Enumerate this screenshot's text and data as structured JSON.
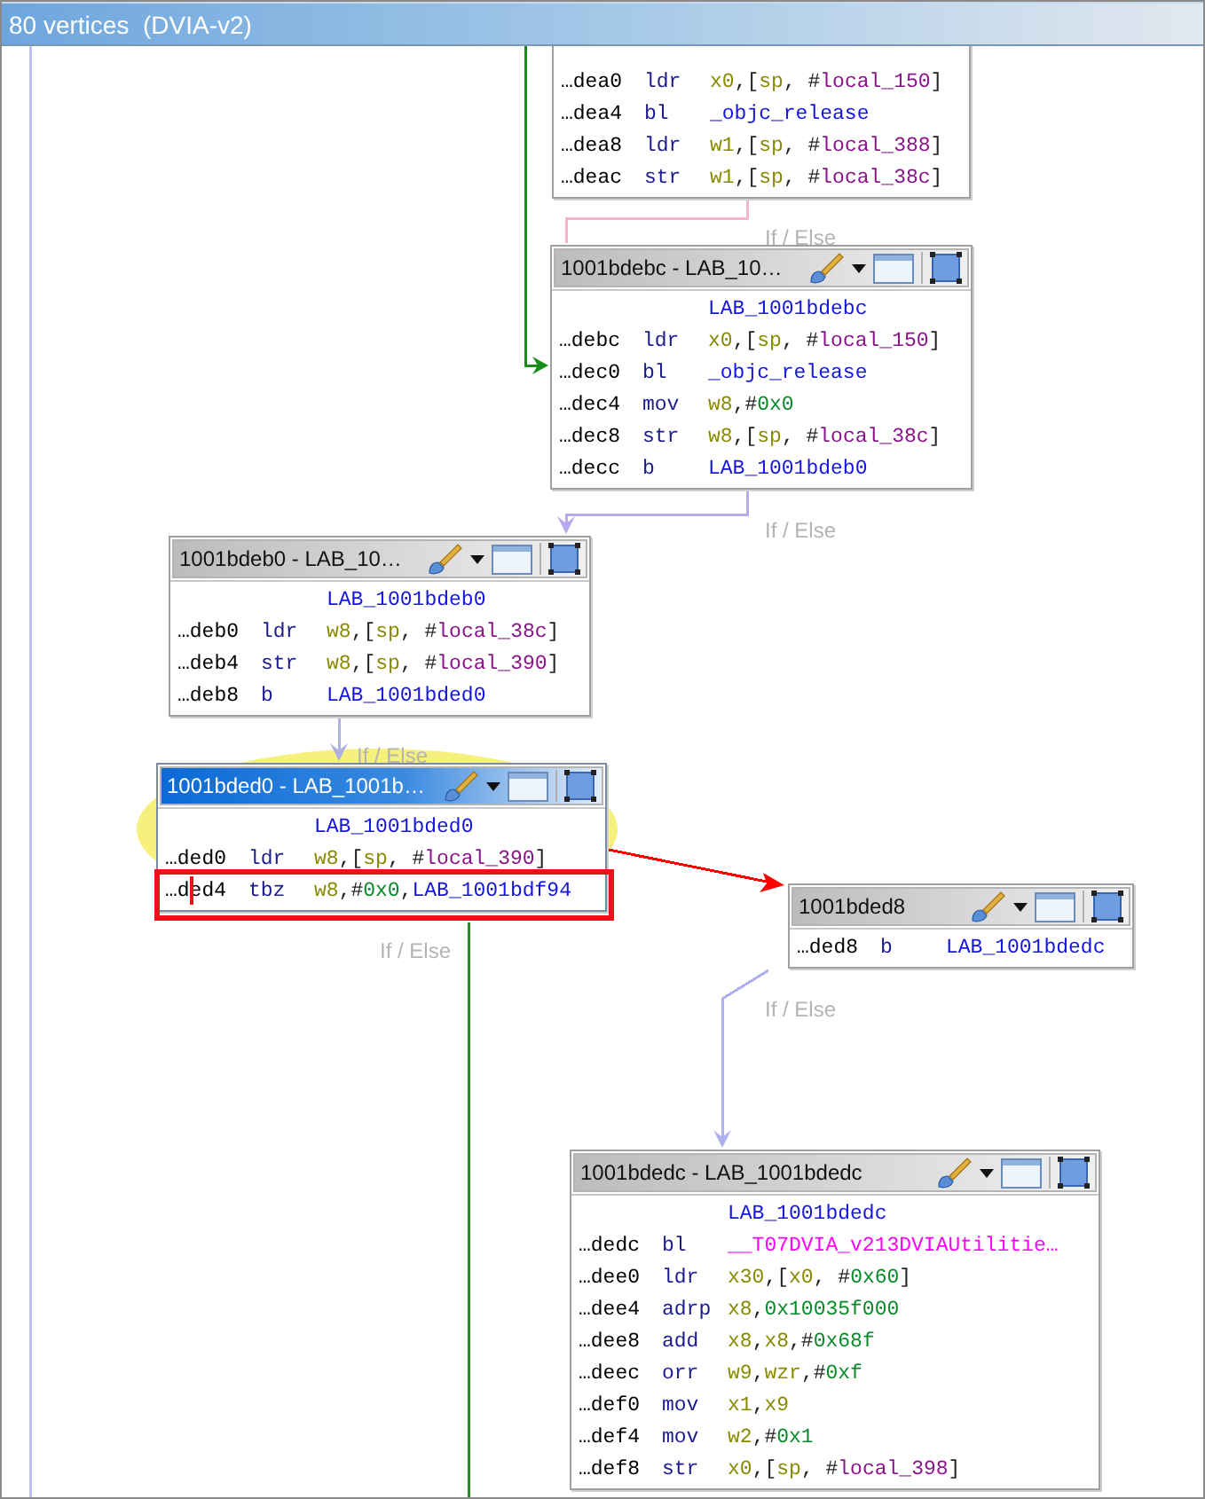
{
  "window": {
    "title": "80 vertices  (DVIA-v2)"
  },
  "blocks": [
    {
      "selected": false,
      "highlighted": false,
      "rows": [
        {
          "address": "…dea0",
          "mnemonic": "ldr",
          "selected": false,
          "operands": [
            {
              "t": "x0",
              "kind": "reg"
            },
            {
              "t": ",[",
              "kind": "punct"
            },
            {
              "t": "sp",
              "kind": "reg"
            },
            {
              "t": ", #",
              "kind": "punct"
            },
            {
              "t": "local_150",
              "kind": "local"
            },
            {
              "t": "]",
              "kind": "punct"
            }
          ]
        },
        {
          "address": "…dea4",
          "mnemonic": "bl",
          "selected": false,
          "operands": [
            {
              "t": "_objc_release",
              "kind": "label"
            }
          ]
        },
        {
          "address": "…dea8",
          "mnemonic": "ldr",
          "selected": false,
          "operands": [
            {
              "t": "w1",
              "kind": "reg"
            },
            {
              "t": ",[",
              "kind": "punct"
            },
            {
              "t": "sp",
              "kind": "reg"
            },
            {
              "t": ", #",
              "kind": "punct"
            },
            {
              "t": "local_388",
              "kind": "local"
            },
            {
              "t": "]",
              "kind": "punct"
            }
          ]
        },
        {
          "address": "…deac",
          "mnemonic": "str",
          "selected": false,
          "operands": [
            {
              "t": "w1",
              "kind": "reg"
            },
            {
              "t": ",[",
              "kind": "punct"
            },
            {
              "t": "sp",
              "kind": "reg"
            },
            {
              "t": ", #",
              "kind": "punct"
            },
            {
              "t": "local_38c",
              "kind": "local"
            },
            {
              "t": "]",
              "kind": "punct"
            }
          ]
        }
      ]
    },
    {
      "title": "1001bdebc - LAB_10…",
      "selected": false,
      "highlighted": false,
      "label": "LAB_1001bdebc",
      "rows": [
        {
          "address": "…debc",
          "mnemonic": "ldr",
          "selected": false,
          "operands": [
            {
              "t": "x0",
              "kind": "reg"
            },
            {
              "t": ",[",
              "kind": "punct"
            },
            {
              "t": "sp",
              "kind": "reg"
            },
            {
              "t": ", #",
              "kind": "punct"
            },
            {
              "t": "local_150",
              "kind": "local"
            },
            {
              "t": "]",
              "kind": "punct"
            }
          ]
        },
        {
          "address": "…dec0",
          "mnemonic": "bl",
          "selected": false,
          "operands": [
            {
              "t": "_objc_release",
              "kind": "label"
            }
          ]
        },
        {
          "address": "…dec4",
          "mnemonic": "mov",
          "selected": false,
          "operands": [
            {
              "t": "w8",
              "kind": "reg"
            },
            {
              "t": ",#",
              "kind": "punct"
            },
            {
              "t": "0x0",
              "kind": "num"
            }
          ]
        },
        {
          "address": "…dec8",
          "mnemonic": "str",
          "selected": false,
          "operands": [
            {
              "t": "w8",
              "kind": "reg"
            },
            {
              "t": ",[",
              "kind": "punct"
            },
            {
              "t": "sp",
              "kind": "reg"
            },
            {
              "t": ", #",
              "kind": "punct"
            },
            {
              "t": "local_38c",
              "kind": "local"
            },
            {
              "t": "]",
              "kind": "punct"
            }
          ]
        },
        {
          "address": "…decc",
          "mnemonic": "b",
          "selected": false,
          "operands": [
            {
              "t": "LAB_1001bdeb0",
              "kind": "label"
            }
          ]
        }
      ]
    },
    {
      "title": "1001bdeb0 - LAB_10…",
      "selected": false,
      "highlighted": false,
      "label": "LAB_1001bdeb0",
      "rows": [
        {
          "address": "…deb0",
          "mnemonic": "ldr",
          "selected": false,
          "operands": [
            {
              "t": "w8",
              "kind": "reg"
            },
            {
              "t": ",[",
              "kind": "punct"
            },
            {
              "t": "sp",
              "kind": "reg"
            },
            {
              "t": ", #",
              "kind": "punct"
            },
            {
              "t": "local_38c",
              "kind": "local"
            },
            {
              "t": "]",
              "kind": "punct"
            }
          ]
        },
        {
          "address": "…deb4",
          "mnemonic": "str",
          "selected": false,
          "operands": [
            {
              "t": "w8",
              "kind": "reg"
            },
            {
              "t": ",[",
              "kind": "punct"
            },
            {
              "t": "sp",
              "kind": "reg"
            },
            {
              "t": ", #",
              "kind": "punct"
            },
            {
              "t": "local_390",
              "kind": "local"
            },
            {
              "t": "]",
              "kind": "punct"
            }
          ]
        },
        {
          "address": "…deb8",
          "mnemonic": "b",
          "selected": false,
          "operands": [
            {
              "t": "LAB_1001bded0",
              "kind": "label"
            }
          ]
        }
      ]
    },
    {
      "title": "1001bded0 - LAB_1001b…",
      "selected": true,
      "highlighted": true,
      "label": "LAB_1001bded0",
      "rows": [
        {
          "address": "…ded0",
          "mnemonic": "ldr",
          "selected": false,
          "operands": [
            {
              "t": "w8",
              "kind": "reg"
            },
            {
              "t": ",[",
              "kind": "punct"
            },
            {
              "t": "sp",
              "kind": "reg"
            },
            {
              "t": ", #",
              "kind": "punct"
            },
            {
              "t": "local_390",
              "kind": "local"
            },
            {
              "t": "]",
              "kind": "punct"
            }
          ]
        },
        {
          "address": "…ded4",
          "mnemonic": "tbz",
          "selected": true,
          "operands": [
            {
              "t": "w8",
              "kind": "reg"
            },
            {
              "t": ",#",
              "kind": "punct"
            },
            {
              "t": "0x0",
              "kind": "num"
            },
            {
              "t": ",",
              "kind": "punct"
            },
            {
              "t": "LAB_1001bdf94",
              "kind": "label"
            }
          ]
        }
      ]
    },
    {
      "title": "1001bded8",
      "selected": false,
      "highlighted": false,
      "rows": [
        {
          "address": "…ded8",
          "mnemonic": "b",
          "selected": false,
          "operands": [
            {
              "t": "LAB_1001bdedc",
              "kind": "label"
            }
          ]
        }
      ]
    },
    {
      "title": "1001bdedc - LAB_1001bdedc",
      "selected": false,
      "highlighted": false,
      "label": "LAB_1001bdedc",
      "rows": [
        {
          "address": "…dedc",
          "mnemonic": "bl",
          "selected": false,
          "operands": [
            {
              "t": "__T07DVIA_v213DVIAUtilitie…",
              "kind": "func"
            }
          ]
        },
        {
          "address": "…dee0",
          "mnemonic": "ldr",
          "selected": false,
          "operands": [
            {
              "t": "x30",
              "kind": "reg"
            },
            {
              "t": ",[",
              "kind": "punct"
            },
            {
              "t": "x0",
              "kind": "reg"
            },
            {
              "t": ", #",
              "kind": "punct"
            },
            {
              "t": "0x60",
              "kind": "num"
            },
            {
              "t": "]",
              "kind": "punct"
            }
          ]
        },
        {
          "address": "…dee4",
          "mnemonic": "adrp",
          "selected": false,
          "operands": [
            {
              "t": "x8",
              "kind": "reg"
            },
            {
              "t": ",",
              "kind": "punct"
            },
            {
              "t": "0x10035f000",
              "kind": "num"
            }
          ]
        },
        {
          "address": "…dee8",
          "mnemonic": "add",
          "selected": false,
          "operands": [
            {
              "t": "x8",
              "kind": "reg"
            },
            {
              "t": ",",
              "kind": "punct"
            },
            {
              "t": "x8",
              "kind": "reg"
            },
            {
              "t": ",#",
              "kind": "punct"
            },
            {
              "t": "0x68f",
              "kind": "num"
            }
          ]
        },
        {
          "address": "…deec",
          "mnemonic": "orr",
          "selected": false,
          "operands": [
            {
              "t": "w9",
              "kind": "reg"
            },
            {
              "t": ",",
              "kind": "punct"
            },
            {
              "t": "wzr",
              "kind": "reg"
            },
            {
              "t": ",#",
              "kind": "punct"
            },
            {
              "t": "0xf",
              "kind": "num"
            }
          ]
        },
        {
          "address": "…def0",
          "mnemonic": "mov",
          "selected": false,
          "operands": [
            {
              "t": "x1",
              "kind": "reg"
            },
            {
              "t": ",",
              "kind": "punct"
            },
            {
              "t": "x9",
              "kind": "reg"
            }
          ]
        },
        {
          "address": "…def4",
          "mnemonic": "mov",
          "selected": false,
          "operands": [
            {
              "t": "w2",
              "kind": "reg"
            },
            {
              "t": ",#",
              "kind": "punct"
            },
            {
              "t": "0x1",
              "kind": "num"
            }
          ]
        },
        {
          "address": "…def8",
          "mnemonic": "str",
          "selected": false,
          "operands": [
            {
              "t": "x0",
              "kind": "reg"
            },
            {
              "t": ",[",
              "kind": "punct"
            },
            {
              "t": "sp",
              "kind": "reg"
            },
            {
              "t": ", #",
              "kind": "punct"
            },
            {
              "t": "local_398",
              "kind": "local"
            },
            {
              "t": "]",
              "kind": "punct"
            }
          ]
        }
      ]
    }
  ],
  "edges": [
    {
      "color": "#1a8c1a"
    },
    {
      "color": "#f7b4c4",
      "label": "If / Else"
    },
    {
      "color": "#b8a8f0",
      "label": "If / Else"
    },
    {
      "color": "#b0b0e0",
      "label": "If / Else"
    },
    {
      "color": "#ff0000"
    },
    {
      "color": "#2a8a2a",
      "label": "If / Else"
    },
    {
      "color": "#b0b0f0",
      "label": "If / Else"
    },
    {
      "color": "#c0c0f4"
    }
  ]
}
